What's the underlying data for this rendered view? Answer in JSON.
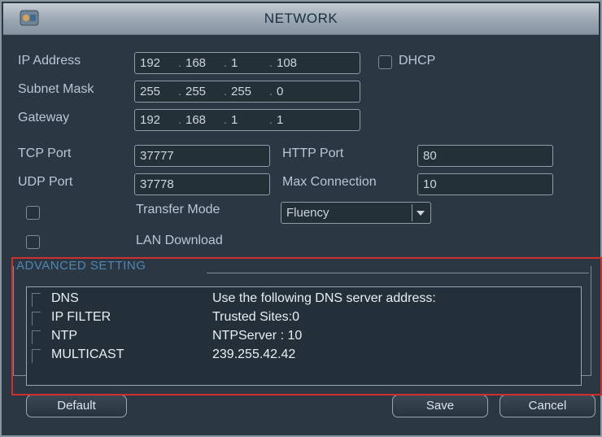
{
  "window": {
    "title": "NETWORK",
    "logo_icon": "device-logo-icon"
  },
  "form": {
    "ip_label": "IP Address",
    "ip": [
      "192",
      "168",
      "1",
      "108"
    ],
    "dhcp_label": "DHCP",
    "subnet_label": "Subnet Mask",
    "subnet": [
      "255",
      "255",
      "255",
      "0"
    ],
    "gateway_label": "Gateway",
    "gateway": [
      "192",
      "168",
      "1",
      "1"
    ],
    "tcp_label": "TCP Port",
    "tcp_value": "37777",
    "http_label": "HTTP Port",
    "http_value": "80",
    "udp_label": "UDP Port",
    "udp_value": "37778",
    "maxconn_label": "Max Connection",
    "maxconn_value": "10",
    "transfer_label": "Transfer Mode",
    "transfer_value": "Fluency",
    "lan_label": "LAN Download"
  },
  "advanced": {
    "title": "ADVANCED SETTING",
    "rows": [
      {
        "name": "DNS",
        "value": "Use the following DNS server address:"
      },
      {
        "name": "IP FILTER",
        "value": "Trusted Sites:0"
      },
      {
        "name": "NTP",
        "value": "NTPServer : 10"
      },
      {
        "name": "MULTICAST",
        "value": "239.255.42.42"
      }
    ]
  },
  "buttons": {
    "default": "Default",
    "save": "Save",
    "cancel": "Cancel"
  },
  "colors": {
    "highlight": "#d0302a",
    "label": "#b9c7d4",
    "background": "#2b3844"
  }
}
